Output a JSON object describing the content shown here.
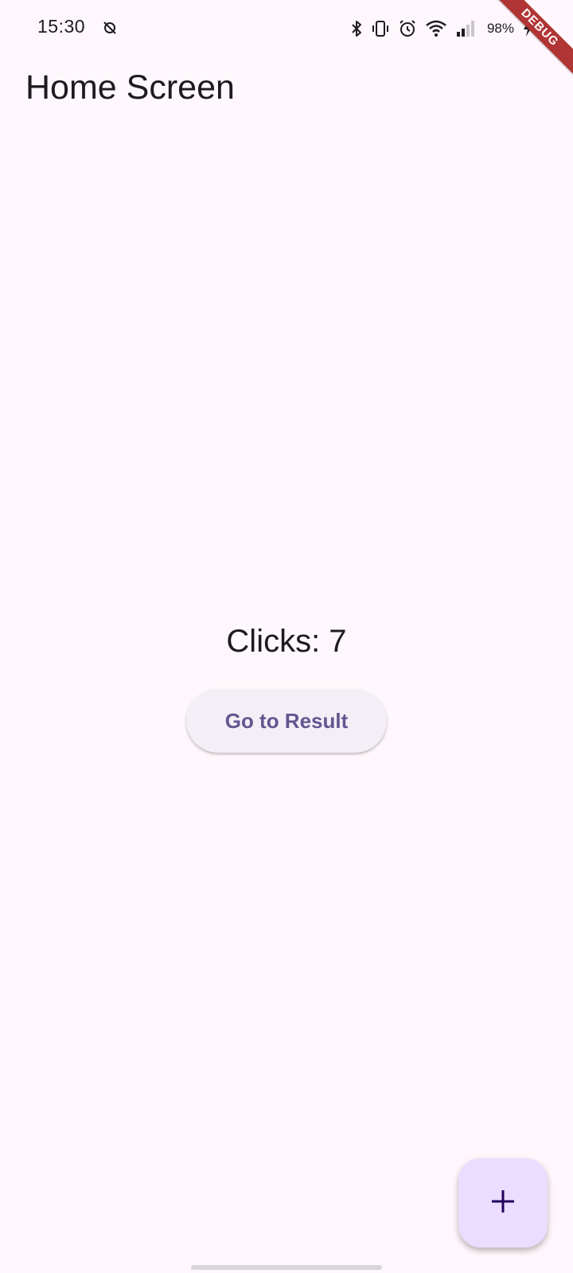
{
  "status_bar": {
    "time": "15:30",
    "left_icon": "no-sync-icon",
    "icons": [
      "bluetooth-icon",
      "vibrate-icon",
      "alarm-icon",
      "wifi-icon",
      "signal-icon"
    ],
    "battery_percent": "98%",
    "battery_icon": "battery-charging-icon"
  },
  "debug_banner": {
    "label": "DEBUG",
    "color": "#b13535"
  },
  "app_bar": {
    "title": "Home Screen"
  },
  "main": {
    "clicks_text": "Clicks: 7",
    "result_button_label": "Go to Result"
  },
  "fab": {
    "icon": "add-icon",
    "color": "#eaddff"
  },
  "colors": {
    "background": "#fef7fb",
    "accent": "#65558f",
    "text": "#1d1b20"
  }
}
